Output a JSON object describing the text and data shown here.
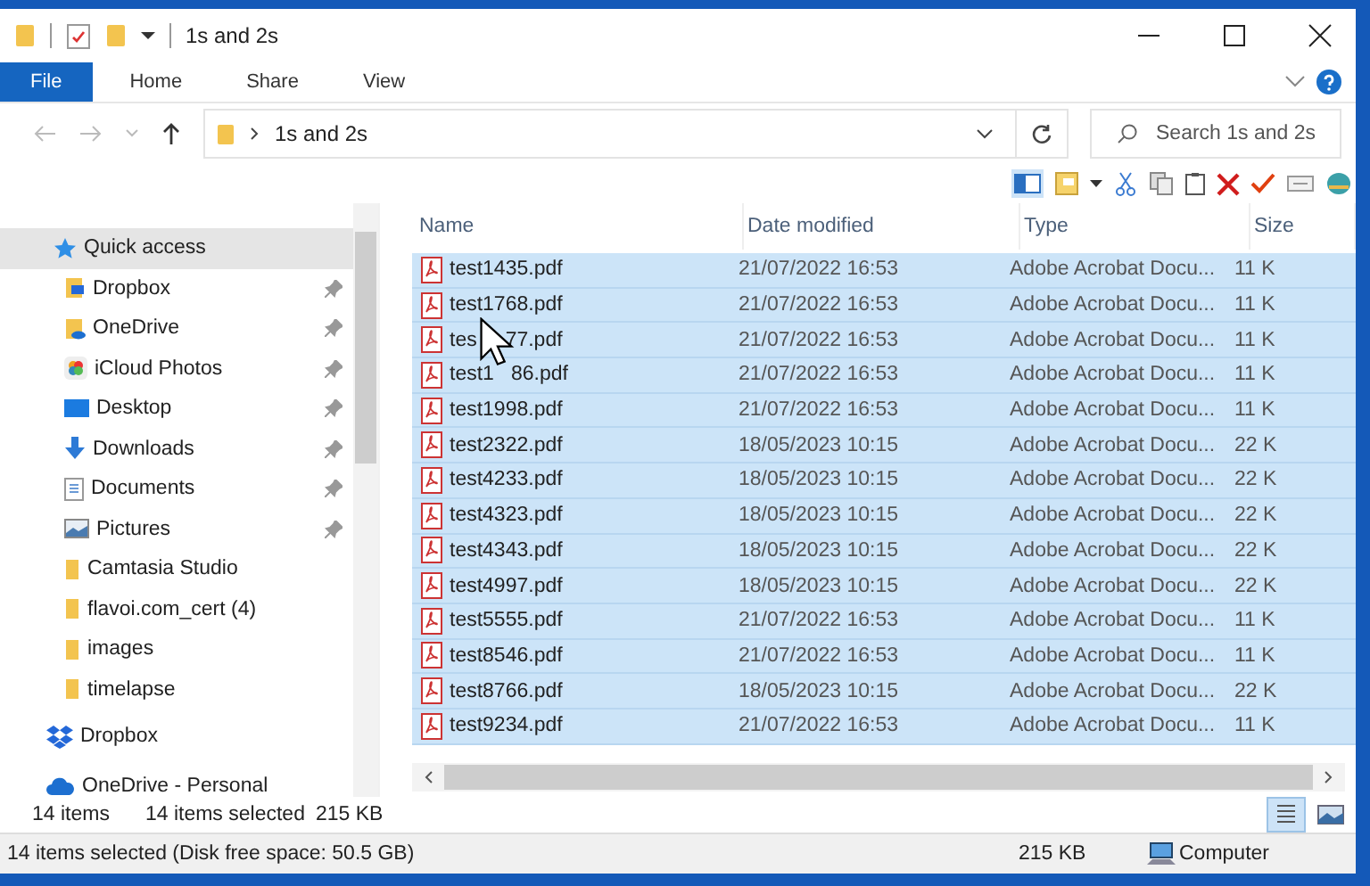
{
  "window": {
    "title": "1s and 2s"
  },
  "ribbon_tabs": [
    {
      "label": "File",
      "selected": true
    },
    {
      "label": "Home",
      "selected": false
    },
    {
      "label": "Share",
      "selected": false
    },
    {
      "label": "View",
      "selected": false
    }
  ],
  "address": {
    "path": "1s and 2s"
  },
  "search": {
    "placeholder": "Search 1s and 2s"
  },
  "sidebar": {
    "items": [
      {
        "label": "Quick access",
        "kind": "quick",
        "selected": true,
        "pinned": false
      },
      {
        "label": "Dropbox",
        "kind": "dropbox-folder",
        "selected": false,
        "pinned": true
      },
      {
        "label": "OneDrive",
        "kind": "onedrive-folder",
        "selected": false,
        "pinned": true
      },
      {
        "label": "iCloud Photos",
        "kind": "photos",
        "selected": false,
        "pinned": true
      },
      {
        "label": "Desktop",
        "kind": "desktop",
        "selected": false,
        "pinned": true
      },
      {
        "label": "Downloads",
        "kind": "downloads",
        "selected": false,
        "pinned": true
      },
      {
        "label": "Documents",
        "kind": "documents",
        "selected": false,
        "pinned": true
      },
      {
        "label": "Pictures",
        "kind": "pictures",
        "selected": false,
        "pinned": true
      },
      {
        "label": "Camtasia Studio",
        "kind": "folder",
        "selected": false,
        "pinned": false
      },
      {
        "label": "flavoi.com_cert (4)",
        "kind": "folder",
        "selected": false,
        "pinned": false
      },
      {
        "label": "images",
        "kind": "folder",
        "selected": false,
        "pinned": false
      },
      {
        "label": "timelapse",
        "kind": "folder",
        "selected": false,
        "pinned": false
      },
      {
        "label": "Dropbox",
        "kind": "dropbox",
        "selected": false,
        "pinned": false
      },
      {
        "label": "OneDrive - Personal",
        "kind": "onedrive",
        "selected": false,
        "pinned": false
      }
    ]
  },
  "table": {
    "columns": [
      "Name",
      "Date modified",
      "Type",
      "Size"
    ],
    "rows": [
      {
        "name": "test1435.pdf",
        "date": "21/07/2022 16:53",
        "type": "Adobe Acrobat Docu...",
        "size": "11 K",
        "selected": true
      },
      {
        "name": "test1768.pdf",
        "date": "21/07/2022 16:53",
        "type": "Adobe Acrobat Docu...",
        "size": "11 K",
        "selected": true
      },
      {
        "name": "tes     77.pdf",
        "date": "21/07/2022 16:53",
        "type": "Adobe Acrobat Docu...",
        "size": "11 K",
        "selected": true
      },
      {
        "name": "test1   86.pdf",
        "date": "21/07/2022 16:53",
        "type": "Adobe Acrobat Docu...",
        "size": "11 K",
        "selected": true
      },
      {
        "name": "test1998.pdf",
        "date": "21/07/2022 16:53",
        "type": "Adobe Acrobat Docu...",
        "size": "11 K",
        "selected": true
      },
      {
        "name": "test2322.pdf",
        "date": "18/05/2023 10:15",
        "type": "Adobe Acrobat Docu...",
        "size": "22 K",
        "selected": true
      },
      {
        "name": "test4233.pdf",
        "date": "18/05/2023 10:15",
        "type": "Adobe Acrobat Docu...",
        "size": "22 K",
        "selected": true
      },
      {
        "name": "test4323.pdf",
        "date": "18/05/2023 10:15",
        "type": "Adobe Acrobat Docu...",
        "size": "22 K",
        "selected": true
      },
      {
        "name": "test4343.pdf",
        "date": "18/05/2023 10:15",
        "type": "Adobe Acrobat Docu...",
        "size": "22 K",
        "selected": true
      },
      {
        "name": "test4997.pdf",
        "date": "18/05/2023 10:15",
        "type": "Adobe Acrobat Docu...",
        "size": "22 K",
        "selected": true
      },
      {
        "name": "test5555.pdf",
        "date": "21/07/2022 16:53",
        "type": "Adobe Acrobat Docu...",
        "size": "11 K",
        "selected": true
      },
      {
        "name": "test8546.pdf",
        "date": "21/07/2022 16:53",
        "type": "Adobe Acrobat Docu...",
        "size": "11 K",
        "selected": true
      },
      {
        "name": "test8766.pdf",
        "date": "18/05/2023 10:15",
        "type": "Adobe Acrobat Docu...",
        "size": "22 K",
        "selected": true
      },
      {
        "name": "test9234.pdf",
        "date": "21/07/2022 16:53",
        "type": "Adobe Acrobat Docu...",
        "size": "11 K",
        "selected": true
      }
    ]
  },
  "status_bar": {
    "item_count": "14 items",
    "selection": "14 items selected",
    "selection_size": "215 KB"
  },
  "details_bar": {
    "summary": "14 items selected (Disk free space: 50.5 GB)",
    "size": "215 KB",
    "location": "Computer"
  }
}
